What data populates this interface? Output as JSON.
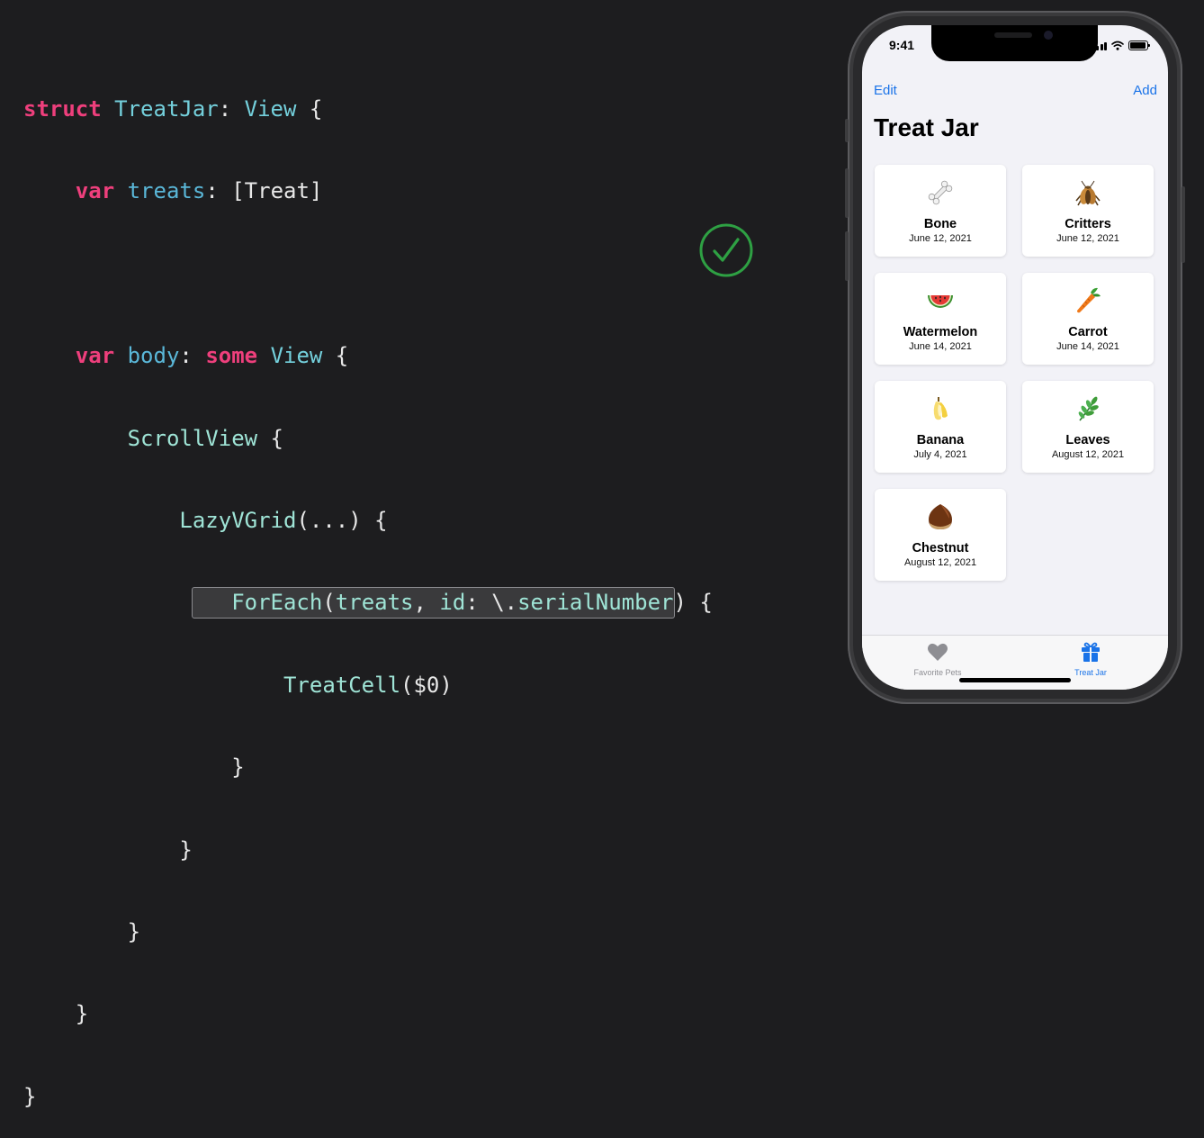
{
  "code": {
    "l1": {
      "a": "struct",
      "b": "TreatJar",
      "c": ": ",
      "d": "View",
      "e": " {"
    },
    "l2": {
      "a": "var",
      "b": "treats",
      "c": ": [",
      "d": "Treat",
      "e": "]"
    },
    "l4": {
      "a": "var",
      "b": "body",
      "c": ": ",
      "d": "some",
      "e": " ",
      "f": "View",
      "g": " {"
    },
    "l5": {
      "a": "ScrollView",
      "b": " {"
    },
    "l6": {
      "a": "LazyVGrid",
      "b": "(...) {"
    },
    "l7": {
      "a": "ForEach",
      "b": "(",
      "c": "treats",
      "d": ", ",
      "e": "id",
      "f": ": \\.",
      "g": "serialNumber",
      "h": ") {"
    },
    "l8": {
      "a": "TreatCell",
      "b": "($0)"
    },
    "close": "}"
  },
  "phone": {
    "time": "9:41",
    "nav": {
      "edit": "Edit",
      "add": "Add"
    },
    "title": "Treat Jar",
    "treats": [
      {
        "name": "Bone",
        "date": "June 12, 2021",
        "icon": "bone-icon"
      },
      {
        "name": "Critters",
        "date": "June 12, 2021",
        "icon": "cricket-icon"
      },
      {
        "name": "Watermelon",
        "date": "June 14, 2021",
        "icon": "watermelon-icon"
      },
      {
        "name": "Carrot",
        "date": "June 14, 2021",
        "icon": "carrot-icon"
      },
      {
        "name": "Banana",
        "date": "July 4, 2021",
        "icon": "banana-icon"
      },
      {
        "name": "Leaves",
        "date": "August 12, 2021",
        "icon": "leaves-icon"
      },
      {
        "name": "Chestnut",
        "date": "August 12, 2021",
        "icon": "chestnut-icon"
      }
    ],
    "tabs": {
      "pets": "Favorite Pets",
      "jar": "Treat Jar"
    }
  },
  "colors": {
    "keyword": "#ee3f7c",
    "type": "#74d0dc",
    "accent": "#1a73e8",
    "check": "#2ea043"
  }
}
